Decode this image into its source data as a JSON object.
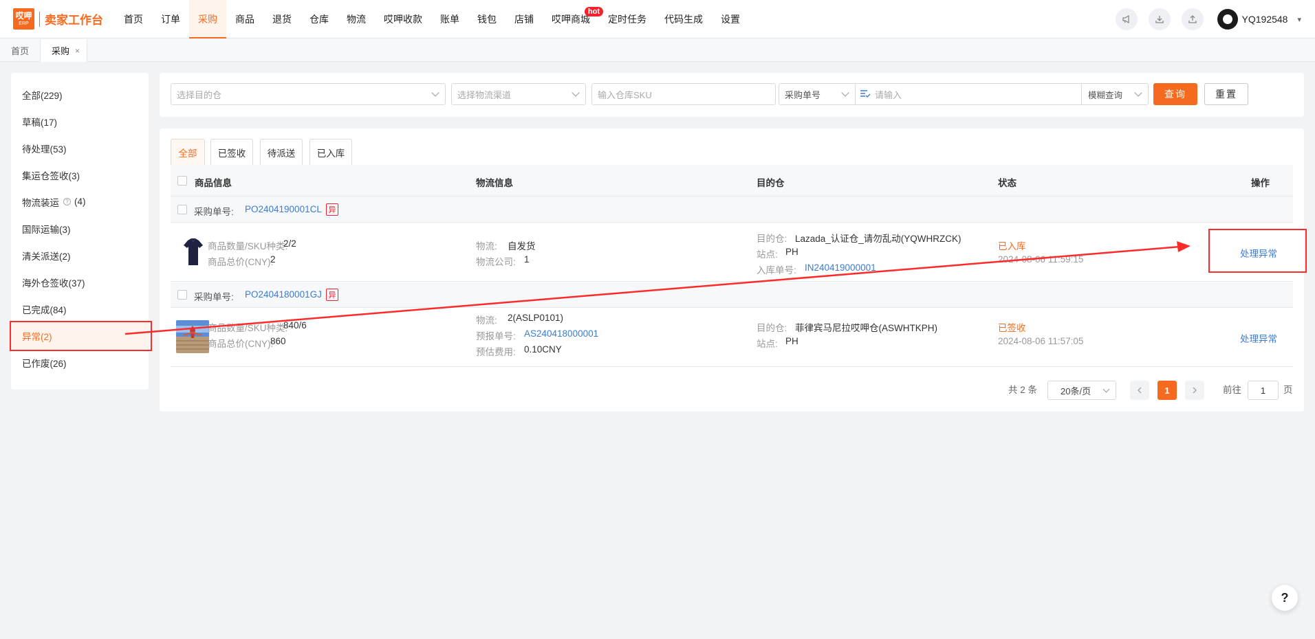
{
  "brand": {
    "logo_line1": "哎呷",
    "logo_line2": "ERP",
    "title": "卖家工作台"
  },
  "nav": {
    "items": [
      "首页",
      "订单",
      "采购",
      "商品",
      "退货",
      "仓库",
      "物流",
      "哎呷收款",
      "账单",
      "钱包",
      "店铺",
      "哎呷商城",
      "定时任务",
      "代码生成",
      "设置"
    ],
    "active_index": 2,
    "hot_badge": "hot",
    "username": "YQ192548"
  },
  "page_tabs": {
    "home": "首页",
    "current": "采购",
    "close": "×"
  },
  "sidebar": {
    "items": [
      {
        "label": "全部(229)"
      },
      {
        "label": "草稿(17)"
      },
      {
        "label": "待处理(53)"
      },
      {
        "label": "集运仓签收(3)"
      },
      {
        "label": "物流装运",
        "count": "(4)"
      },
      {
        "label": "国际运输(3)"
      },
      {
        "label": "清关派送(2)"
      },
      {
        "label": "海外仓签收(37)"
      },
      {
        "label": "已完成(84)"
      },
      {
        "label": "异常(2)"
      },
      {
        "label": "已作废(26)"
      }
    ],
    "active_index": 9
  },
  "filters": {
    "warehouse_placeholder": "选择目的仓",
    "channel_placeholder": "选择物流渠道",
    "sku_placeholder": "输入仓库SKU",
    "order_type": "采购单号",
    "keyword_placeholder": "请输入",
    "match_mode": "模糊查询",
    "search_label": "查询",
    "reset_label": "重置"
  },
  "status_tabs": [
    "全部",
    "已签收",
    "待派送",
    "已入库"
  ],
  "table": {
    "headers": {
      "product": "商品信息",
      "logistics": "物流信息",
      "dest": "目的仓",
      "status": "状态",
      "action": "操作"
    },
    "groups": [
      {
        "po_label": "采购单号:",
        "po_number": "PO2404190001CL",
        "badge": "异",
        "qty_label": "商品数量/SKU种类:",
        "qty_value": "2/2",
        "total_label": "商品总价(CNY):",
        "total_value": "2",
        "logistics_label": "物流:",
        "logistics_value": "自发货",
        "company_label": "物流公司:",
        "company_value": "1",
        "dest_label": "目的仓:",
        "dest_value": "Lazada_认证仓_请勿乱动(YQWHRZCK)",
        "site_label": "站点:",
        "site_value": "PH",
        "inbound_label": "入库单号:",
        "inbound_value": "IN240419000001",
        "status": "已入库",
        "status_time": "2024-08-06 11:59:15",
        "action": "处理异常"
      },
      {
        "po_label": "采购单号:",
        "po_number": "PO2404180001GJ",
        "badge": "异",
        "qty_label": "商品数量/SKU种类:",
        "qty_value": "840/6",
        "total_label": "商品总价(CNY):",
        "total_value": "860",
        "logistics_label": "物流:",
        "logistics_value": "2(ASLP0101)",
        "forecast_label": "预报单号:",
        "forecast_value": "AS240418000001",
        "fee_label": "预估费用:",
        "fee_value": "0.10CNY",
        "dest_label": "目的仓:",
        "dest_value": "菲律宾马尼拉哎呷仓(ASWHTKPH)",
        "site_label": "站点:",
        "site_value": "PH",
        "status": "已签收",
        "status_time": "2024-08-06 11:57:05",
        "action": "处理异常"
      }
    ]
  },
  "pagination": {
    "total": "共 2 条",
    "page_size": "20条/页",
    "current": "1",
    "goto_label": "前往",
    "goto_value": "1",
    "page_unit": "页"
  },
  "help": "?",
  "colors": {
    "accent": "#f56a1e",
    "link": "#3a7bd5",
    "annotation": "#ff2a2a"
  }
}
